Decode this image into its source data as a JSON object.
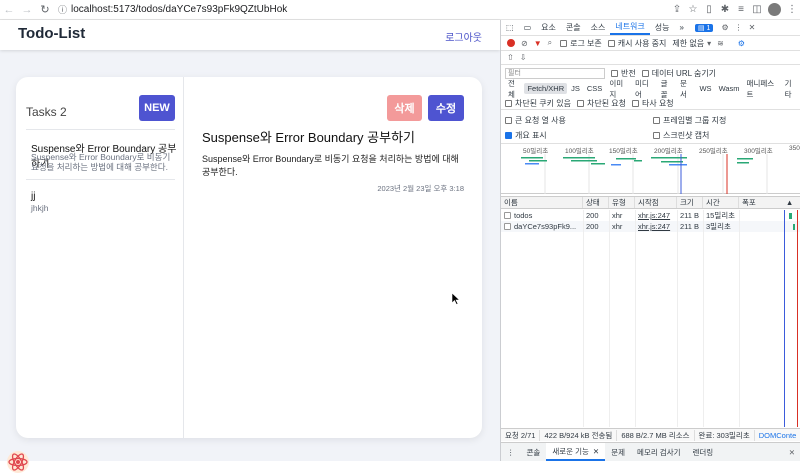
{
  "browser": {
    "url": "localhost:5173/todos/daYCe7s93pFk9QZtUbHok"
  },
  "app": {
    "title": "Todo-List",
    "logout_label": "로그아웃",
    "task_count_label": "Tasks 2",
    "new_button": "NEW",
    "delete_button": "삭제",
    "edit_button": "수정",
    "todos": [
      {
        "title": "Suspense와 Error Boundary 공부하기",
        "desc": "Suspense와 Error Boundary로 비동기 요청을 처리하는 방법에 대해 공부한다."
      },
      {
        "title": "jj",
        "desc": "jhkjh"
      }
    ],
    "detail": {
      "title": "Suspense와 Error Boundary 공부하기",
      "body": "Suspense와 Error Boundary로 비동기 요청을 처리하는 방법에 대해 공부한다.",
      "date": "2023년 2월 23일 오후 3:18"
    }
  },
  "devtools": {
    "tabs": [
      "요소",
      "콘솔",
      "소스",
      "네트워크",
      "성능",
      "»"
    ],
    "active_tab": "네트워크",
    "message_badge": "1",
    "toolbar": {
      "preserve_log": "로그 보존",
      "disable_cache": "캐시 사용 중지",
      "throttle": "제한 없음"
    },
    "filter": {
      "placeholder": "필터",
      "invert": "반전",
      "hide_data_urls": "데이터 URL 숨기기"
    },
    "types": [
      "전체",
      "Fetch/XHR",
      "JS",
      "CSS",
      "이미지",
      "미디어",
      "글꼴",
      "문서",
      "WS",
      "Wasm",
      "매니페스트",
      "기타"
    ],
    "active_type": "Fetch/XHR",
    "blocked_cookies": "차단된 쿠키 있음",
    "blocked_requests": "차단된 요청",
    "third_party": "타사 요청",
    "options": {
      "big_rows": "큰 요청 열 사용",
      "group_by_frame": "프레임별 그룹 지정",
      "overview": "개요 표시",
      "screenshots": "스크린샷 캡처"
    },
    "overview_ticks": [
      "50밀리초",
      "100밀리초",
      "150밀리초",
      "200밀리초",
      "250밀리초",
      "300밀리초",
      "350"
    ],
    "columns": [
      "이름",
      "상태",
      "유형",
      "시작점",
      "크기",
      "시간",
      "폭포"
    ],
    "rows": [
      {
        "name": "todos",
        "status": "200",
        "type": "xhr",
        "initiator": "xhr.js:247",
        "size": "211 B",
        "time": "15밀리초"
      },
      {
        "name": "daYCe7s93pFk9...",
        "status": "200",
        "type": "xhr",
        "initiator": "xhr.js:247",
        "size": "211 B",
        "time": "3밀리초"
      }
    ],
    "status": {
      "requests": "요청 2/71",
      "transferred": "422 B/924 kB 전송됨",
      "resources": "688 B/2.7 MB 리소스",
      "finish": "완료: 303밀리초",
      "dom": "DOMConte"
    },
    "drawer_tabs": [
      "콘솔",
      "새로운 기능",
      "문제",
      "메모리 검사기",
      "렌더링"
    ],
    "drawer_active": "새로운 기능"
  },
  "colors": {
    "primary": "#4e54d1",
    "danger": "#f39a9a",
    "devtools_accent": "#1a73e8"
  }
}
